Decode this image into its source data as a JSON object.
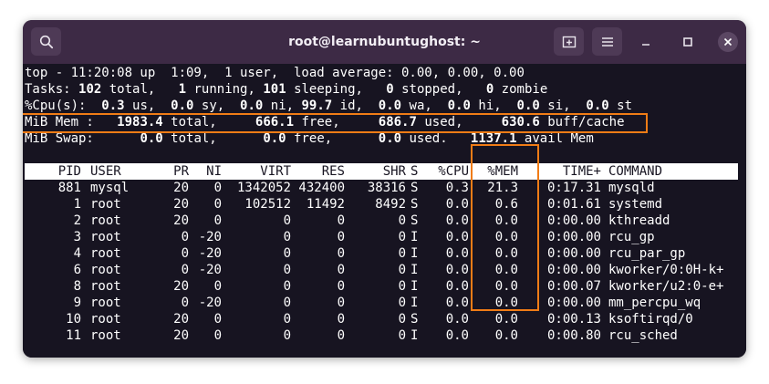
{
  "window": {
    "title": "root@learnubuntughost: ~",
    "accent_color": "#f07c16"
  },
  "top": {
    "l1": {
      "a": "top - 11:20:08 up  1:09,  1 user,  load average: 0.00, 0.00, 0.00"
    },
    "l2": {
      "a": "Tasks: ",
      "b": "102",
      "c": " total,   ",
      "d": "1",
      "e": " running, ",
      "f": "101",
      "g": " sleeping,   ",
      "h": "0",
      "i": " stopped,   ",
      "j": "0",
      "k": " zombie"
    },
    "l3": {
      "a": "%Cpu(s):  ",
      "b": "0.3",
      "c": " us,  ",
      "d": "0.0",
      "e": " sy,  ",
      "f": "0.0",
      "g": " ni, ",
      "h": "99.7",
      "i": " id,  ",
      "j": "0.0",
      "k": " wa,  ",
      "l": "0.0",
      "m": " hi,  ",
      "n": "0.0",
      "o": " si,  ",
      "p": "0.0",
      "q": " st"
    },
    "l4": {
      "a": "MiB Mem :   ",
      "b": "1983.4",
      "c": " total,     ",
      "d": "666.1",
      "e": " free,     ",
      "f": "686.7",
      "g": " used,     ",
      "h": "630.6",
      "i": " buff/cache"
    },
    "l5": {
      "a": "MiB Swap:      ",
      "b": "0.0",
      "c": " total,      ",
      "d": "0.0",
      "e": " free,      ",
      "f": "0.0",
      "g": " used.   ",
      "h": "1137.1",
      "i": " avail Mem"
    }
  },
  "columns": [
    "PID",
    "USER",
    "PR",
    "NI",
    "VIRT",
    "RES",
    "SHR",
    "S",
    "%CPU",
    "%MEM",
    "TIME+",
    "COMMAND"
  ],
  "processes": [
    [
      "881",
      "mysql",
      "20",
      "0",
      "1342052",
      "432400",
      "38316",
      "S",
      "0.3",
      "21.3",
      "0:17.31",
      "mysqld"
    ],
    [
      "1",
      "root",
      "20",
      "0",
      "102512",
      "11492",
      "8492",
      "S",
      "0.0",
      "0.6",
      "0:01.61",
      "systemd"
    ],
    [
      "2",
      "root",
      "20",
      "0",
      "0",
      "0",
      "0",
      "S",
      "0.0",
      "0.0",
      "0:00.00",
      "kthreadd"
    ],
    [
      "3",
      "root",
      "0",
      "-20",
      "0",
      "0",
      "0",
      "I",
      "0.0",
      "0.0",
      "0:00.00",
      "rcu_gp"
    ],
    [
      "4",
      "root",
      "0",
      "-20",
      "0",
      "0",
      "0",
      "I",
      "0.0",
      "0.0",
      "0:00.00",
      "rcu_par_gp"
    ],
    [
      "6",
      "root",
      "0",
      "-20",
      "0",
      "0",
      "0",
      "I",
      "0.0",
      "0.0",
      "0:00.00",
      "kworker/0:0H-k+"
    ],
    [
      "8",
      "root",
      "20",
      "0",
      "0",
      "0",
      "0",
      "I",
      "0.0",
      "0.0",
      "0:00.07",
      "kworker/u2:0-e+"
    ],
    [
      "9",
      "root",
      "0",
      "-20",
      "0",
      "0",
      "0",
      "I",
      "0.0",
      "0.0",
      "0:00.00",
      "mm_percpu_wq"
    ],
    [
      "10",
      "root",
      "20",
      "0",
      "0",
      "0",
      "0",
      "S",
      "0.0",
      "0.0",
      "0:00.13",
      "ksoftirqd/0"
    ],
    [
      "11",
      "root",
      "20",
      "0",
      "0",
      "0",
      "0",
      "I",
      "0.0",
      "0.0",
      "0:00.80",
      "rcu_sched"
    ]
  ]
}
